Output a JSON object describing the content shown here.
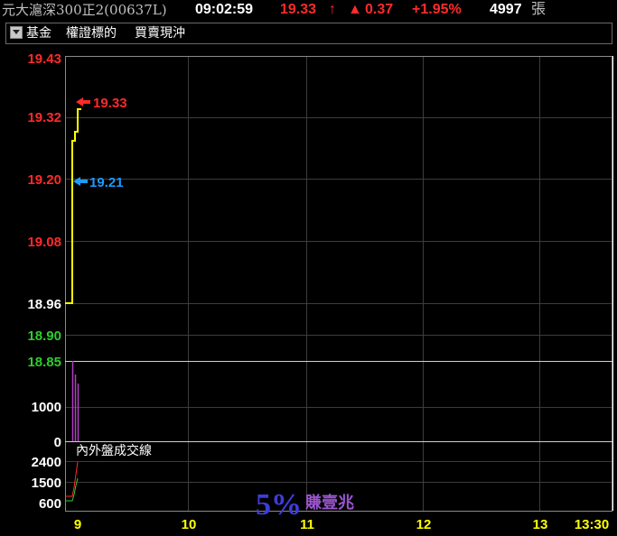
{
  "header": {
    "name": "元大滬深300正2(00637L)",
    "time": "09:02:59",
    "price": "19.33",
    "arrow": "↑",
    "change_symbol": "▲",
    "change": "0.37",
    "percent": "+1.95%",
    "volume": "4997",
    "volume_unit": "張"
  },
  "menu": {
    "items": [
      "基金",
      "權證標的",
      "買賣現沖"
    ]
  },
  "price_axis": {
    "labels": [
      {
        "text": "19.43",
        "color": "#ff2a2a"
      },
      {
        "text": "19.32",
        "color": "#ff2a2a"
      },
      {
        "text": "19.20",
        "color": "#ff2a2a"
      },
      {
        "text": "19.08",
        "color": "#ff2a2a"
      },
      {
        "text": "18.96",
        "color": "#ffffff"
      },
      {
        "text": "18.90",
        "color": "#2ecc2e"
      },
      {
        "text": "18.85",
        "color": "#2ecc2e"
      }
    ]
  },
  "volume_axis": {
    "labels": [
      "1000",
      "0"
    ]
  },
  "flow_axis": {
    "labels": [
      "2400",
      "1500",
      "600"
    ]
  },
  "flow_panel_title": "內外盤成交線",
  "markers": {
    "high": {
      "text": "19.33",
      "color": "#ff2a2a"
    },
    "avg": {
      "text": "19.21",
      "color": "#1e9bff"
    }
  },
  "x_axis": {
    "labels": [
      "9",
      "10",
      "11",
      "12",
      "13",
      "13:30"
    ]
  },
  "watermark": {
    "big": "5%",
    "small": "賺壹兆"
  },
  "colors": {
    "price_line": "#ffff00",
    "volume_bars": "#b040c0",
    "grid": "#3c3c3c",
    "divider": "#d0d0d0",
    "up": "#ff2a2a",
    "down": "#2ecc2e"
  },
  "chart_data": {
    "type": "line",
    "x": [
      "09:00",
      "09:00",
      "09:01",
      "09:01",
      "09:02",
      "09:02",
      "09:03"
    ],
    "y": [
      18.96,
      19.28,
      19.28,
      19.3,
      19.3,
      19.33,
      19.33
    ],
    "ylim": [
      18.85,
      19.43
    ],
    "volume": [
      1600,
      1450,
      1200
    ],
    "xlabel": "",
    "ylabel": ""
  }
}
